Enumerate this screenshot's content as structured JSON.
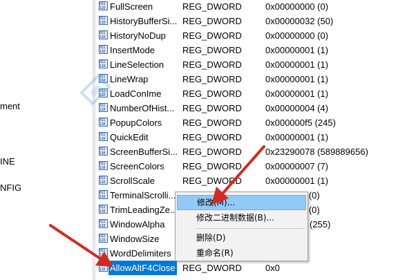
{
  "tree_fragments": [
    "ment",
    "INE",
    "NFIG"
  ],
  "rows": [
    {
      "name": "FullScreen",
      "type": "REG_DWORD",
      "data": "0x00000000 (0)"
    },
    {
      "name": "HistoryBufferSi...",
      "type": "REG_DWORD",
      "data": "0x00000032 (50)"
    },
    {
      "name": "HistoryNoDup",
      "type": "REG_DWORD",
      "data": "0x00000000 (0)"
    },
    {
      "name": "InsertMode",
      "type": "REG_DWORD",
      "data": "0x00000001 (1)"
    },
    {
      "name": "LineSelection",
      "type": "REG_DWORD",
      "data": "0x00000001 (1)"
    },
    {
      "name": "LineWrap",
      "type": "REG_DWORD",
      "data": "0x00000001 (1)"
    },
    {
      "name": "LoadConIme",
      "type": "REG_DWORD",
      "data": "0x00000001 (1)"
    },
    {
      "name": "NumberOfHist...",
      "type": "REG_DWORD",
      "data": "0x00000004 (4)"
    },
    {
      "name": "PopupColors",
      "type": "REG_DWORD",
      "data": "0x000000f5 (245)"
    },
    {
      "name": "QuickEdit",
      "type": "REG_DWORD",
      "data": "0x00000001 (1)"
    },
    {
      "name": "ScreenBufferSi...",
      "type": "REG_DWORD",
      "data": "0x23290078 (589889656)"
    },
    {
      "name": "ScreenColors",
      "type": "REG_DWORD",
      "data": "0x00000007 (7)"
    },
    {
      "name": "ScrollScale",
      "type": "REG_DWORD",
      "data": "0x00000001 (1)"
    },
    {
      "name": "TerminalScrolli...",
      "type": "REG_DWORD",
      "data": "0 (0)"
    },
    {
      "name": "TrimLeadingZe...",
      "type": "REG_DWORD",
      "data": "0 (0)"
    },
    {
      "name": "WindowAlpha",
      "type": "",
      "data": "(255)"
    },
    {
      "name": "WindowSize",
      "type": "",
      "data": ""
    },
    {
      "name": "WordDelimiters",
      "type": "",
      "data": ""
    },
    {
      "name": "AllowAltF4Close",
      "type": "REG_DWORD",
      "data": "0x0"
    }
  ],
  "context_menu": {
    "modify": "修改(M)...",
    "modify_binary": "修改二进制数据(B)...",
    "delete": "删除(D)",
    "rename": "重命名(R)"
  },
  "colors": {
    "selection": "#0078d7",
    "menu_highlight": "#91c9f7",
    "arrow": "#d42a20"
  }
}
